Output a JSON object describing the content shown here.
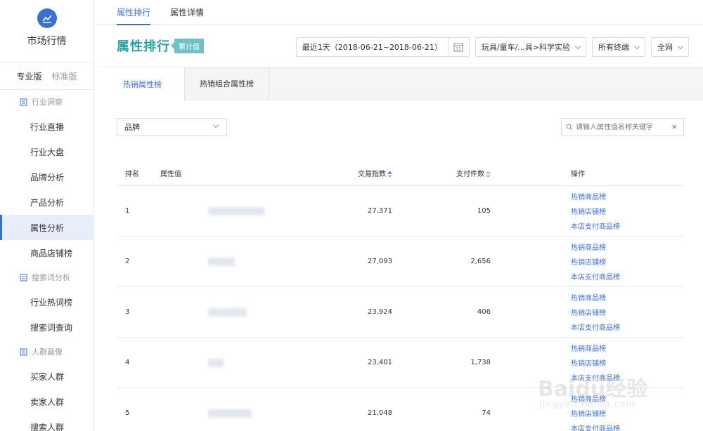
{
  "app": {
    "title": "市场行情"
  },
  "versions": {
    "pro": "专业版",
    "std": "标准版"
  },
  "sidebar": {
    "groups": [
      {
        "label": "行业洞察",
        "items": [
          "行业直播",
          "行业大盘",
          "品牌分析",
          "产品分析",
          "属性分析",
          "商品店铺榜"
        ]
      },
      {
        "label": "搜索词分析",
        "items": [
          "行业热词榜",
          "搜索词查询"
        ]
      },
      {
        "label": "人群画像",
        "items": [
          "买家人群",
          "卖家人群",
          "搜索人群"
        ]
      }
    ],
    "active": "属性分析"
  },
  "top_tabs": [
    "属性排行",
    "属性详情"
  ],
  "header": {
    "title": "属性排行",
    "badge": "累计值"
  },
  "filters": {
    "date": "最近1天（2018-06-21~2018-06-21）",
    "date_icon_num": "15",
    "category": "玩具/童车/...具>科学实验",
    "terminal": "所有终端",
    "scope": "全网"
  },
  "sub_tabs": [
    "热销属性榜",
    "热销组合属性榜"
  ],
  "select": {
    "value": "品牌"
  },
  "search": {
    "placeholder": "请输入属性值名称关键字",
    "clear": "×"
  },
  "table": {
    "headers": {
      "rank": "排名",
      "attr": "属性值",
      "index": "交易指数",
      "pay": "支付件数",
      "op": "操作"
    },
    "rows": [
      {
        "rank": "1",
        "index": "27,371",
        "pay": "105"
      },
      {
        "rank": "2",
        "index": "27,093",
        "pay": "2,656"
      },
      {
        "rank": "3",
        "index": "23,924",
        "pay": "406"
      },
      {
        "rank": "4",
        "index": "23,401",
        "pay": "1,738"
      },
      {
        "rank": "5",
        "index": "21,048",
        "pay": "74"
      }
    ],
    "ops": [
      "热销商品榜",
      "热销店铺榜",
      "本店支付商品榜"
    ]
  },
  "watermark": {
    "text": "Baidu经验",
    "url": "jingyan.baidu.com"
  }
}
